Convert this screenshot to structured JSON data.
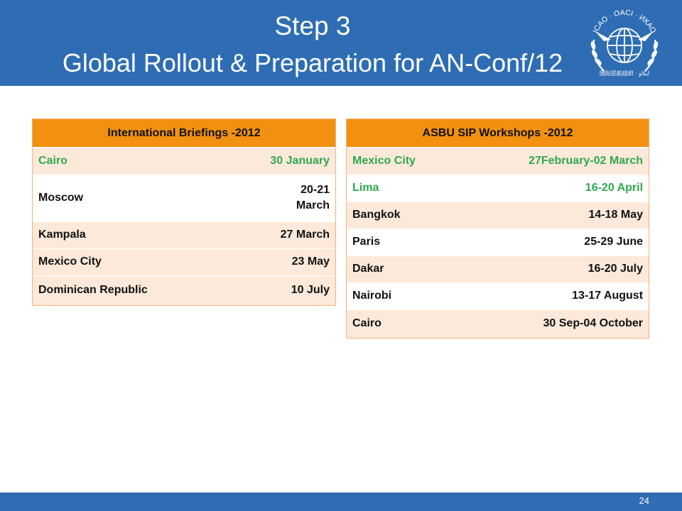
{
  "title": {
    "line1": "Step 3",
    "line2": "Global Rollout & Preparation for AN-Conf/12"
  },
  "logo": {
    "text": "ICAO · OACI · ИКАО",
    "colors": {
      "emblem": "#ffffff"
    }
  },
  "briefings": {
    "header": "International Briefings -2012",
    "rows": [
      {
        "city": "Cairo",
        "date": "30 January",
        "style": "green"
      },
      {
        "city": "Moscow",
        "date": "20-21\nMarch",
        "style": "white"
      },
      {
        "city": "Kampala",
        "date": "27 March",
        "style": "light"
      },
      {
        "city": "Mexico City",
        "date": "23 May",
        "style": "light"
      },
      {
        "city": "Dominican Republic",
        "date": "10 July",
        "style": "light"
      }
    ]
  },
  "workshops": {
    "header": "ASBU SIP Workshops -2012",
    "rows": [
      {
        "city": "Mexico City",
        "date": "27February-02 March",
        "style": "green"
      },
      {
        "city": "Lima",
        "date": "16-20 April",
        "style": "green-white"
      },
      {
        "city": "Bangkok",
        "date": "14-18 May",
        "style": "light"
      },
      {
        "city": "Paris",
        "date": "25-29 June",
        "style": "white"
      },
      {
        "city": "Dakar",
        "date": "16-20 July",
        "style": "light"
      },
      {
        "city": "Nairobi",
        "date": "13-17 August",
        "style": "white"
      },
      {
        "city": "Cairo",
        "date": "30 Sep-04 October",
        "style": "light"
      }
    ]
  },
  "footer": {
    "page_number": "24"
  },
  "colors": {
    "header_blue": "#2E6DB4",
    "table_header_orange": "#F29111",
    "row_light": "#FDE9DA",
    "highlight_green": "#2EA84F"
  }
}
